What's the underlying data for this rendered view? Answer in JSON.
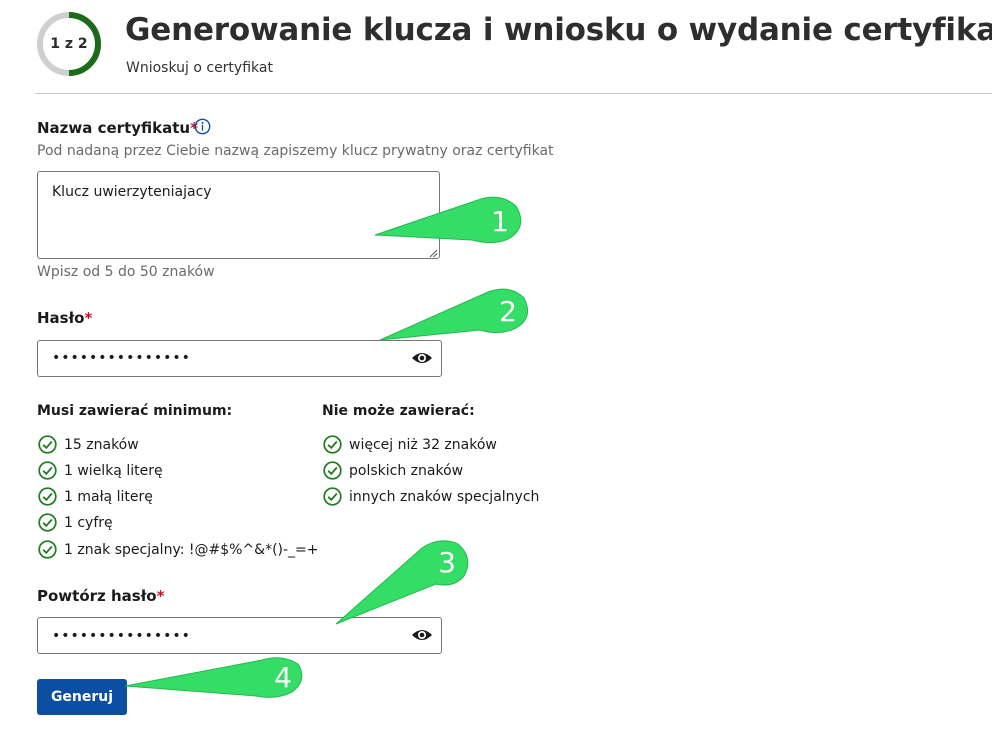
{
  "header": {
    "step": "1 z 2",
    "step_progress": 0.5,
    "title": "Generowanie klucza i wniosku o wydanie certyfikatu",
    "subtitle": "Wnioskuj o certyfikat"
  },
  "form": {
    "cert_name": {
      "label": "Nazwa certyfikatu",
      "required_mark": "*",
      "description": "Pod nadaną przez Ciebie nazwą zapiszemy klucz prywatny oraz certyfikat",
      "value": "Klucz uwierzyteniajacy",
      "hint": "Wpisz od 5 do 50 znaków"
    },
    "password": {
      "label": "Hasło",
      "required_mark": "*",
      "value_masked": "•••••••••••••••"
    },
    "requirements": {
      "must_heading": "Musi zawierać minimum:",
      "must_items": [
        "15 znaków",
        "1 wielką literę",
        "1 małą literę",
        "1 cyfrę",
        "1 znak specjalny: !@#$%^&*()-_=+"
      ],
      "mustnot_heading": "Nie może zawierać:",
      "mustnot_items": [
        "więcej niż 32 znaków",
        "polskich znaków",
        "innych znaków specjalnych"
      ]
    },
    "password_repeat": {
      "label": "Powtórz hasło",
      "required_mark": "*",
      "value_masked": "•••••••••••••••"
    },
    "submit_label": "Generuj"
  },
  "callouts": [
    "1",
    "2",
    "3",
    "4"
  ],
  "colors": {
    "accent": "#0b4ea2",
    "check": "#1e7b1e",
    "required": "#c8102e",
    "progress": "#1a6b1a",
    "callout": "#33dd66"
  }
}
